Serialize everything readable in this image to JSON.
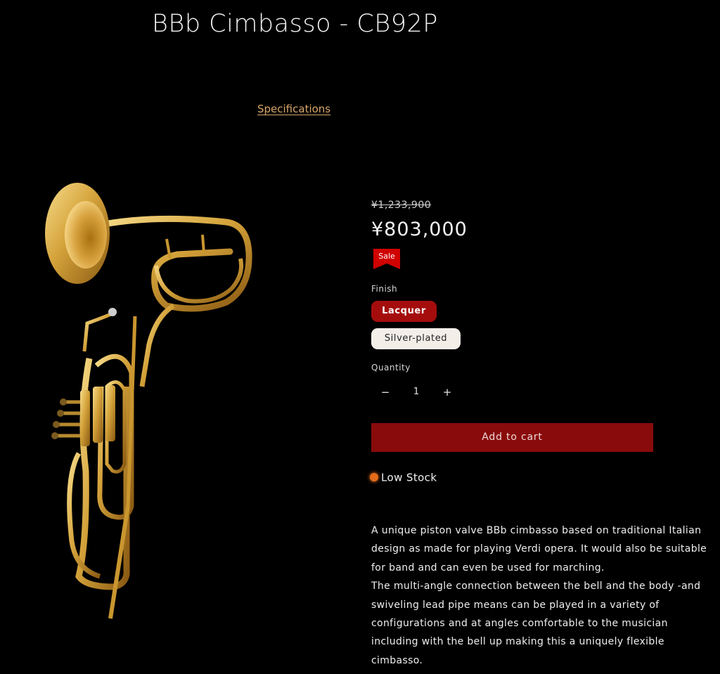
{
  "product": {
    "title": "BBb Cimbasso - CB92P",
    "specifications_link": "Specifications",
    "image_icon": "cimbasso-product-photo"
  },
  "pricing": {
    "compare_at": "¥1,233,900",
    "price": "¥803,000",
    "badge": "Sale"
  },
  "finish": {
    "label": "Finish",
    "options": [
      {
        "label": "Lacquer",
        "selected": true
      },
      {
        "label": "Silver-plated",
        "selected": false
      }
    ]
  },
  "quantity": {
    "label": "Quantity",
    "decrease": "−",
    "value": "1",
    "increase": "+"
  },
  "cart": {
    "add_label": "Add to cart"
  },
  "stock": {
    "label": "Low Stock",
    "indicator_color": "#e46c1a"
  },
  "description": {
    "lines": [
      "A unique piston valve BBb cimbasso based on traditional Italian",
      "design as made for playing Verdi opera. It would also be suitable",
      "for band and can even be used for marching.",
      "The multi-angle connection between the bell and the body -and",
      "swiveling lead pipe means can be played in a variety of",
      "configurations and at angles comfortable to the musician",
      "including with the bell up making this a uniquely flexible",
      "cimbasso."
    ]
  },
  "colors": {
    "background": "#000000",
    "accent_red": "#8a0b0b",
    "selected_red": "#a50d0d",
    "sale_red": "#d00000",
    "link_gold": "#d8a66a",
    "brass": "#d4a23a"
  }
}
